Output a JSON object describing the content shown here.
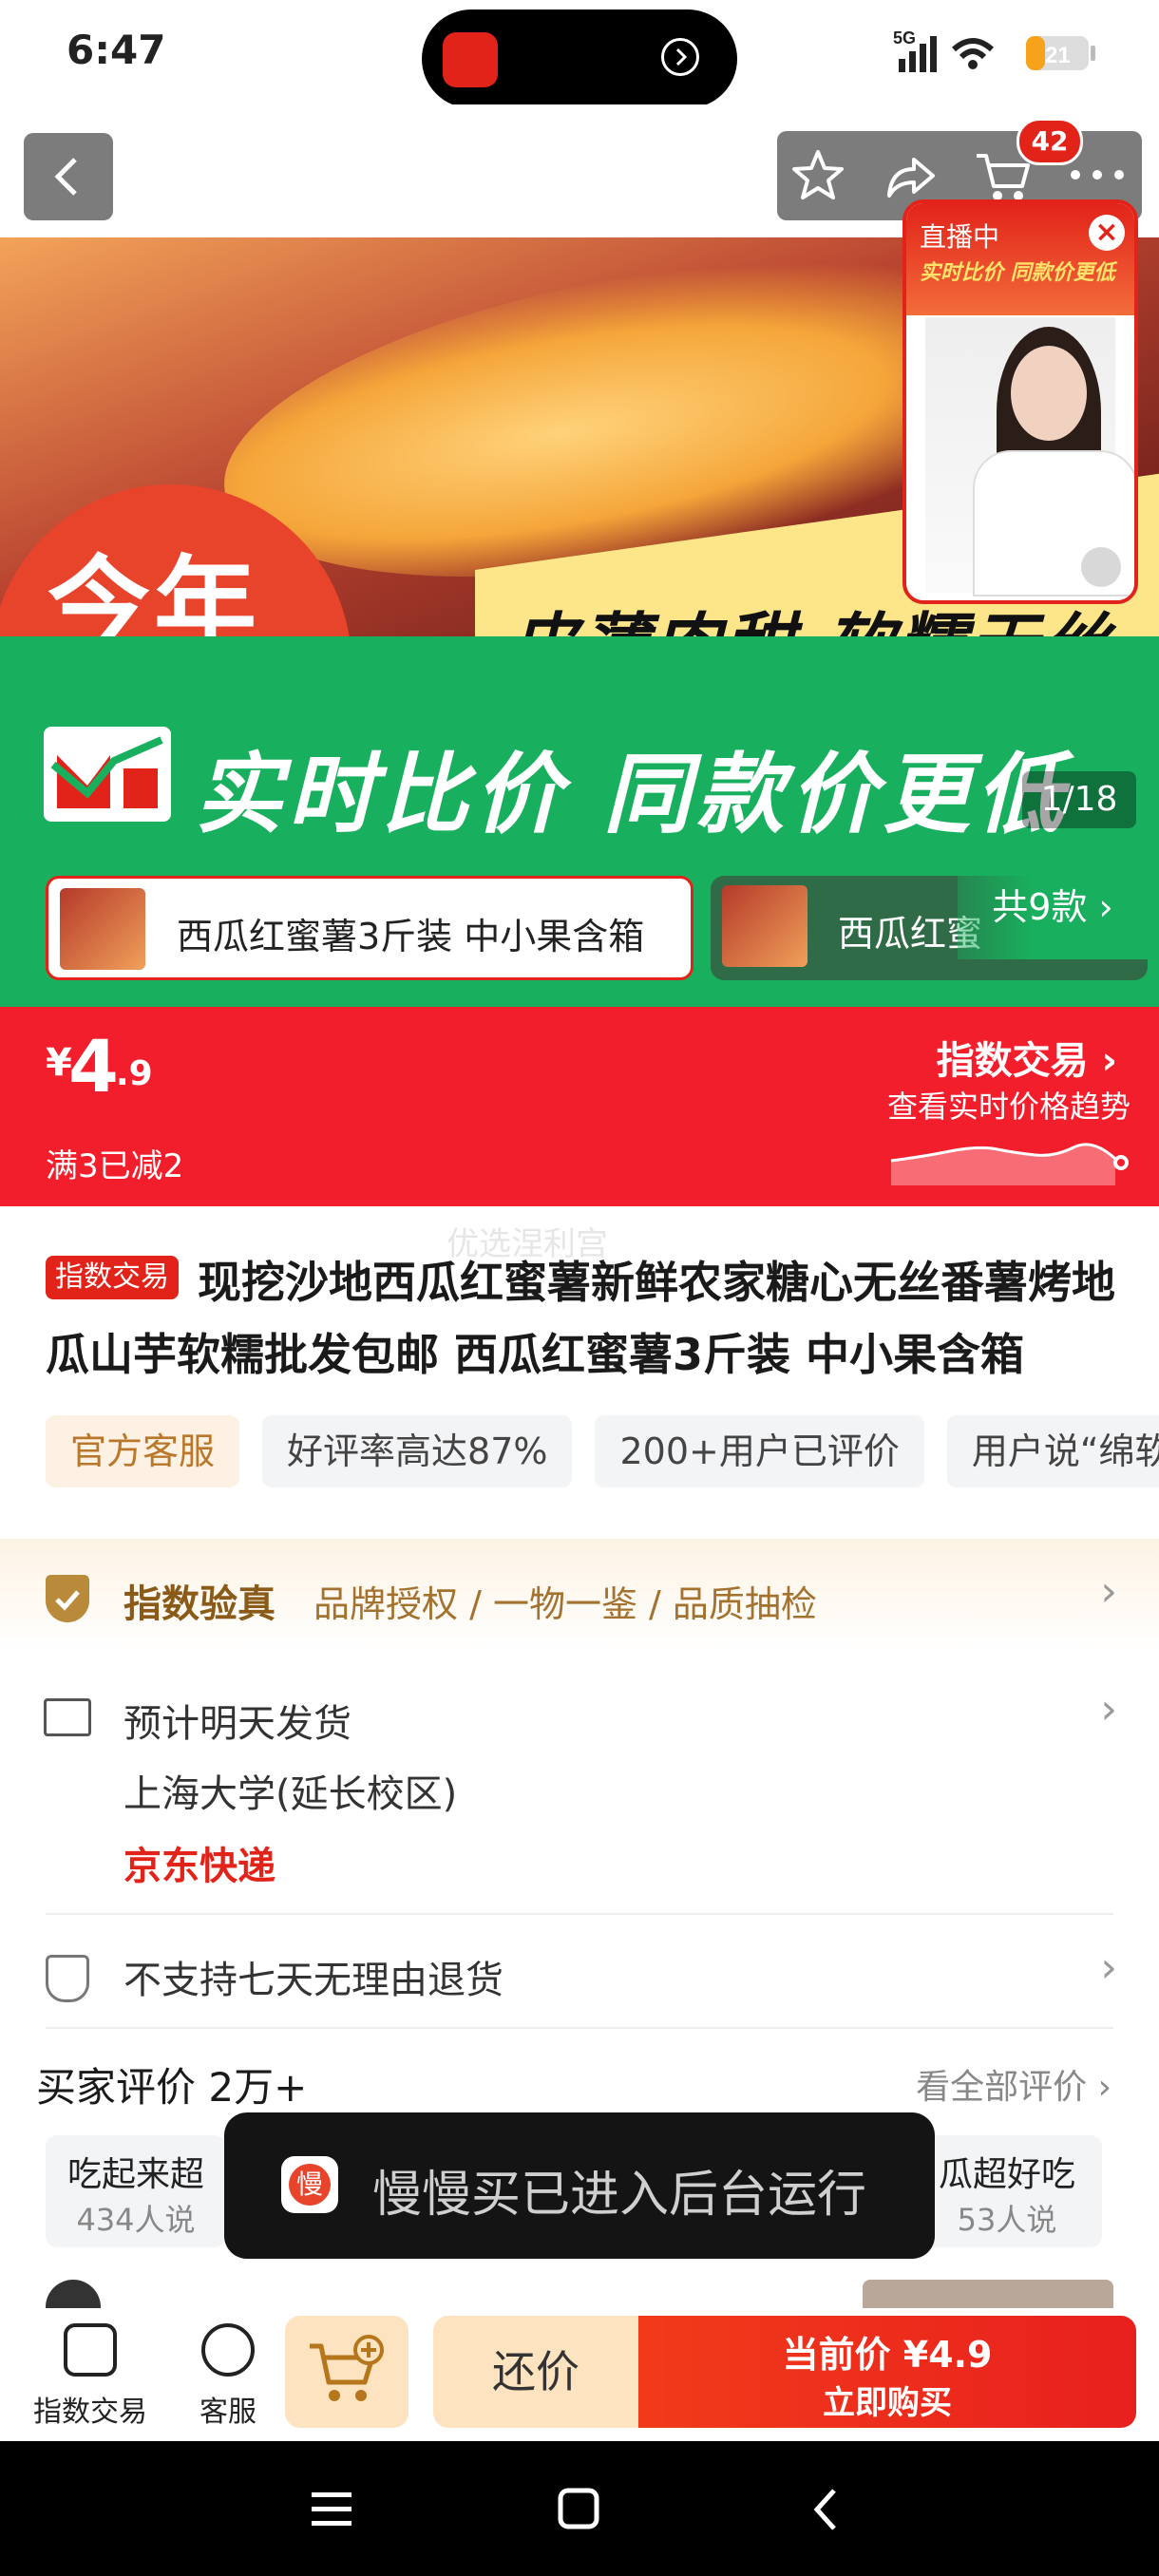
{
  "status_bar": {
    "time": "6:47",
    "network": "5G",
    "battery": "21"
  },
  "nav": {
    "cart_count": "42"
  },
  "hero": {
    "circle_text": "今年",
    "slogan": "皮薄肉甜 软糯无丝",
    "green_text": "实时比价 同款价更低",
    "page_indicator": "1/18"
  },
  "live": {
    "badge": "直播中",
    "banner": "实时比价 同款价更低"
  },
  "variants": {
    "selected_label": "西瓜红蜜薯3斤装 中小果含箱",
    "second_label": "西瓜红蜜",
    "count_label": "共9款 ›"
  },
  "price": {
    "currency": "¥",
    "integer": "4",
    "decimal": ".9",
    "promo": "满3已减2",
    "index_title": "指数交易 ›",
    "index_sub": "查看实时价格趋势"
  },
  "title": {
    "watermark": "优选涅利宫",
    "tag": "指数交易",
    "text": "现挖沙地西瓜红蜜薯新鲜农家糖心无丝番薯烤地瓜山芋软糯批发包邮 西瓜红蜜薯3斤装 中小果含箱",
    "chips": [
      "官方客服",
      "好评率高达87%",
      "200+用户已评价",
      "用户说“绵软"
    ]
  },
  "verify": {
    "title": "指数验真",
    "sub": "品牌授权 / 一物一鉴 / 品质抽检"
  },
  "shipping": {
    "line1": "预计明天发货",
    "line2": "上海大学(延长校区)",
    "line3": "京东快递"
  },
  "returns": {
    "text": "不支持七天无理由退货"
  },
  "reviews": {
    "title": "买家评价 2万+",
    "see_all": "看全部评价 ›",
    "chip1_title": "吃起来超",
    "chip1_sub": "434人说",
    "chip2_title": "瓜超好吃",
    "chip2_sub": "53人说"
  },
  "toast": {
    "text": "慢慢买已进入后台运行",
    "icon_char": "慢"
  },
  "bottom": {
    "tab_index": "指数交易",
    "tab_service": "客服",
    "bargain": "还价",
    "buy_price": "当前价 ¥4.9",
    "buy_label": "立即购买"
  }
}
